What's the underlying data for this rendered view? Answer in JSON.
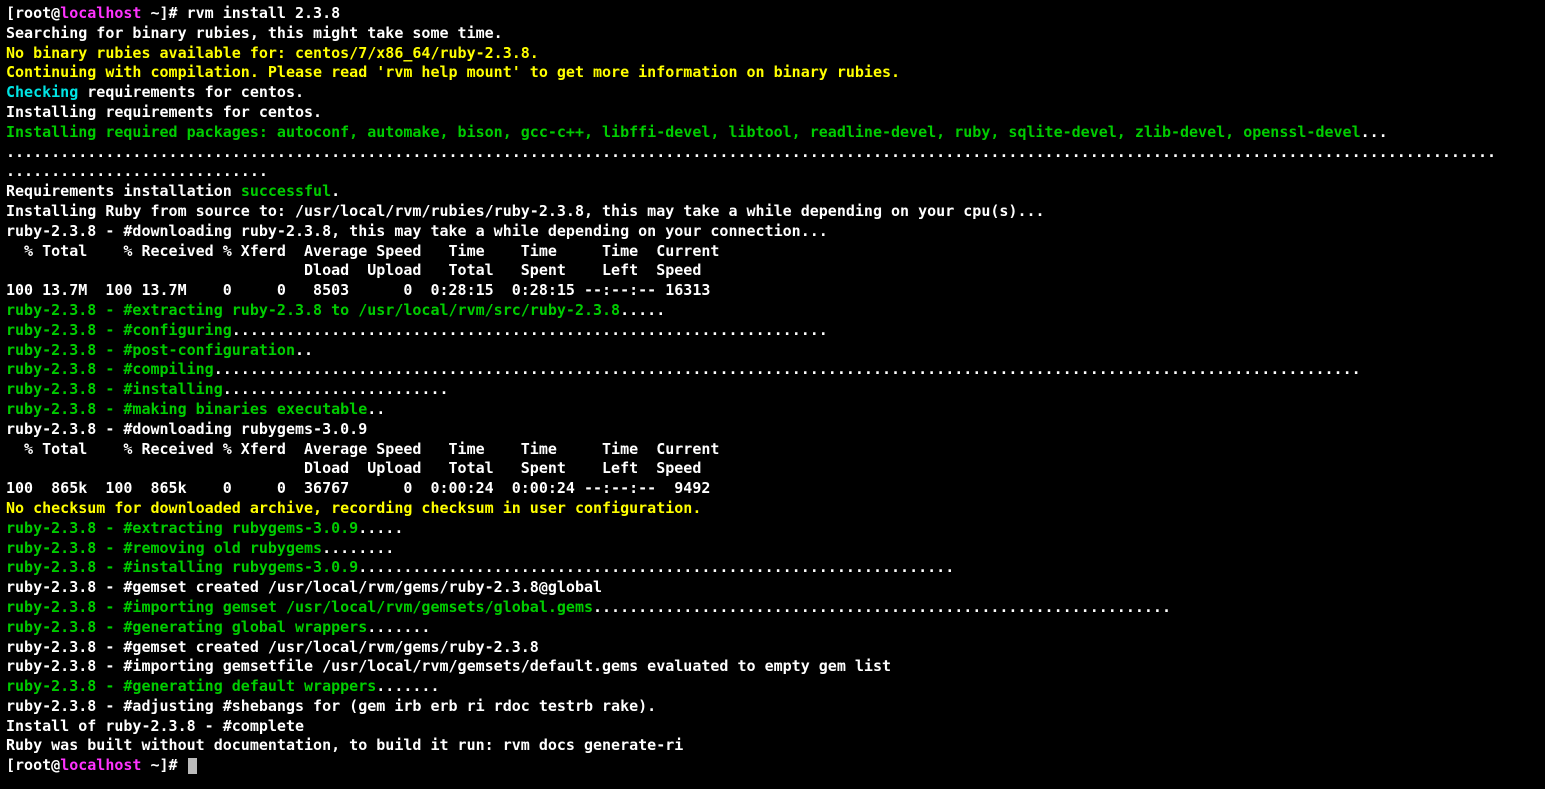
{
  "prompt1": {
    "lbracket": "[",
    "user": "root",
    "at": "@",
    "host": "localhost",
    "tilde": " ~",
    "rbracket": "]# ",
    "cmd": "rvm install 2.3.8"
  },
  "l2": "Searching for binary rubies, this might take some time.",
  "l3": "No binary rubies available for: centos/7/x86_64/ruby-2.3.8.",
  "l4": "Continuing with compilation. Please read 'rvm help mount' to get more information on binary rubies.",
  "l5a": "Checking",
  "l5b": " requirements for centos.",
  "l6": "Installing requirements for centos.",
  "l7a": "Installing required packages: autoconf, automake, bison, gcc-c++, libffi-devel, libtool, readline-devel, ruby, sqlite-devel, zlib-devel, openssl-devel",
  "l7b": "...",
  "l8": ".....................................................................................................................................................................",
  "l9": ".............................",
  "l10a": "Requirements installation ",
  "l10b": "successful",
  "l10c": ".",
  "l11": "Installing Ruby from source to: /usr/local/rvm/rubies/ruby-2.3.8, this may take a while depending on your cpu(s)...",
  "l12": "ruby-2.3.8 - #downloading ruby-2.3.8, this may take a while depending on your connection...",
  "l13": "  % Total    % Received % Xferd  Average Speed   Time    Time     Time  Current",
  "l14": "                                 Dload  Upload   Total   Spent    Left  Speed",
  "l15": "100 13.7M  100 13.7M    0     0   8503      0  0:28:15  0:28:15 --:--:-- 16313",
  "l16a": "ruby-2.3.8 - #extracting ruby-2.3.8 to /usr/local/rvm/src/ruby-2.3.8",
  "l16b": ".....",
  "l17a": "ruby-2.3.8 - #configuring",
  "l17b": "..................................................................",
  "l18a": "ruby-2.3.8 - #post-configuration",
  "l18b": "..",
  "l19a": "ruby-2.3.8 - #compiling",
  "l19b": "...............................................................................................................................",
  "l20a": "ruby-2.3.8 - #installing",
  "l20b": ".........................",
  "l21a": "ruby-2.3.8 - #making binaries executable",
  "l21b": "..",
  "l22": "ruby-2.3.8 - #downloading rubygems-3.0.9",
  "l23": "  % Total    % Received % Xferd  Average Speed   Time    Time     Time  Current",
  "l24": "                                 Dload  Upload   Total   Spent    Left  Speed",
  "l25": "100  865k  100  865k    0     0  36767      0  0:00:24  0:00:24 --:--:--  9492",
  "l26": "No checksum for downloaded archive, recording checksum in user configuration.",
  "l27a": "ruby-2.3.8 - #extracting rubygems-3.0.9",
  "l27b": ".....",
  "l28a": "ruby-2.3.8 - #removing old rubygems",
  "l28b": "........",
  "l29a": "ruby-2.3.8 - #installing rubygems-3.0.9",
  "l29b": "..................................................................",
  "l30": "ruby-2.3.8 - #gemset created /usr/local/rvm/gems/ruby-2.3.8@global",
  "l31a": "ruby-2.3.8 - #importing gemset /usr/local/rvm/gemsets/global.gems",
  "l31b": "................................................................",
  "l32a": "ruby-2.3.8 - #generating global wrappers",
  "l32b": ".......",
  "l33": "ruby-2.3.8 - #gemset created /usr/local/rvm/gems/ruby-2.3.8",
  "l34": "ruby-2.3.8 - #importing gemsetfile /usr/local/rvm/gemsets/default.gems evaluated to empty gem list",
  "l35a": "ruby-2.3.8 - #generating default wrappers",
  "l35b": ".......",
  "l36": "ruby-2.3.8 - #adjusting #shebangs for (gem irb erb ri rdoc testrb rake).",
  "l37": "Install of ruby-2.3.8 - #complete ",
  "l38": "Ruby was built without documentation, to build it run: rvm docs generate-ri",
  "prompt2": {
    "lbracket": "[",
    "user": "root",
    "at": "@",
    "host": "localhost",
    "tilde": " ~",
    "rbracket": "]# "
  }
}
